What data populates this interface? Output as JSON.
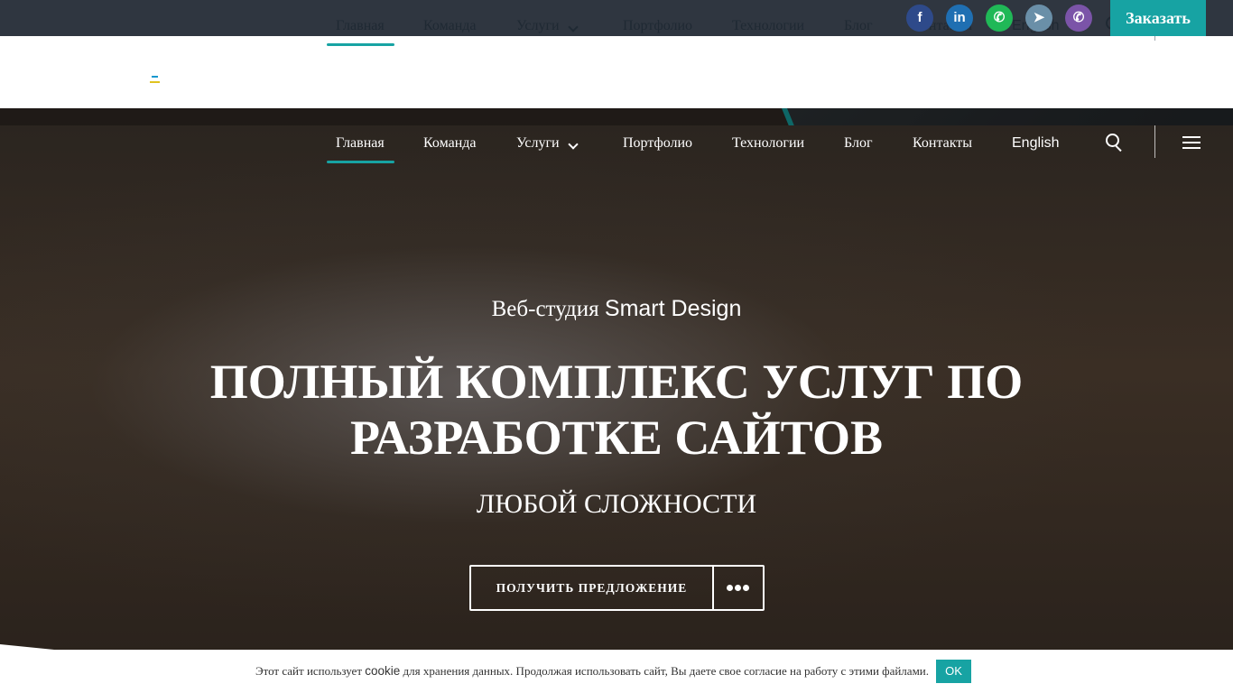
{
  "colors": {
    "accent": "#17a3a3",
    "topbar": "#2f3640",
    "text_dark": "#1f2933"
  },
  "nav": {
    "items": [
      {
        "label": "Главная",
        "active": true
      },
      {
        "label": "Команда"
      },
      {
        "label": "Услуги",
        "has_dropdown": true
      },
      {
        "label": "Портфолио"
      },
      {
        "label": "Технологии"
      },
      {
        "label": "Блог"
      },
      {
        "label": "Контакты"
      }
    ],
    "language": "English",
    "search_icon": "search-icon",
    "menu_icon": "hamburger-icon"
  },
  "social": [
    {
      "name": "facebook-icon",
      "glyph": "f"
    },
    {
      "name": "linkedin-icon",
      "glyph": "in"
    },
    {
      "name": "whatsapp-icon",
      "glyph": "✆"
    },
    {
      "name": "telegram-icon",
      "glyph": "➤"
    },
    {
      "name": "viber-icon",
      "glyph": "✆"
    }
  ],
  "order_button": "Заказать",
  "hero": {
    "pretitle_prefix": "Веб-студия",
    "pretitle_brand": "Smart Design",
    "title": "ПОЛНЫЙ КОМПЛЕКС УСЛУГ ПО РАЗРАБОТКЕ САЙТОВ",
    "subtitle": "ЛЮБОЙ СЛОЖНОСТИ",
    "cta_label": "ПОЛУЧИТЬ ПРЕДЛОЖЕНИЕ",
    "cta_more_icon": "more-dots-icon"
  },
  "cookie": {
    "text_before": "Этот сайт использует",
    "highlight": "cookie",
    "text_after": "для хранения данных. Продолжая использовать сайт, Вы даете свое согласие на работу с этими файлами.",
    "button": "OK"
  }
}
